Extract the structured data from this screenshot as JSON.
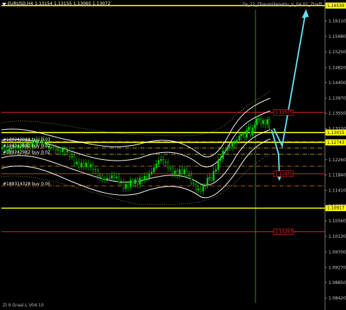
{
  "window": {
    "symbol_header": "EURUSD,H4  1.13154 1.13155 1.13065 1.13072",
    "indicator_name": "Ze_22_Zhaumilienatiu_V_04.02_Ztreft",
    "footer": "ZI 9 Graal-L V04.10"
  },
  "price_axis": {
    "ticks": [
      "1.16110",
      "1.15680",
      "1.15250",
      "1.14820",
      "1.14400",
      "1.13970",
      "1.13550",
      "1.13120",
      "1.12690",
      "1.12260",
      "1.11840",
      "1.11410",
      "1.10980",
      "1.10560",
      "1.10130",
      "1.09700",
      "1.09270",
      "1.08850",
      "1.08420"
    ],
    "current_price": "1.13015"
  },
  "levels": [
    {
      "label": "1.16539",
      "color": "#ffff00"
    },
    {
      "label": "1.13575",
      "color": "#ff3030"
    },
    {
      "label": "1.13015",
      "color": "#ffff00"
    },
    {
      "label": "1.12743",
      "color": "#ffff00"
    },
    {
      "label": "1.11870",
      "color": "#ff3030"
    },
    {
      "label": "1.10917",
      "color": "#ffff00"
    },
    {
      "label": "1.10263",
      "color": "#ff3030"
    }
  ],
  "orders": [
    {
      "text": "#189242988 buy 0.03"
    },
    {
      "text": "#189242982 buy 0.02"
    },
    {
      "text": "#189242982 buy 0.02"
    },
    {
      "text": "#189314328 buy 0.05"
    }
  ],
  "colors": {
    "background": "#000000",
    "bull_candle": "#00d000",
    "bear_candle": "#000000",
    "envelope": "#ffffff",
    "support": "#ffff00",
    "resistance": "#ff3030",
    "arrow": "#66ddee",
    "vline": "#4aa04a"
  }
}
